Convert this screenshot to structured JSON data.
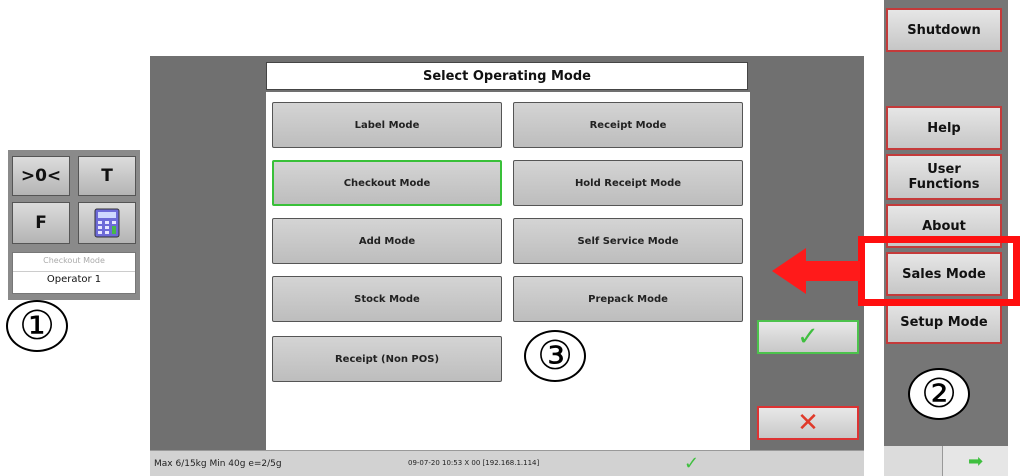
{
  "left_panel": {
    "zero_label": ">0<",
    "tare_label": "T",
    "f_label": "F",
    "mode_text": "Checkout Mode",
    "operator_text": "Operator 1"
  },
  "callouts": {
    "one": "①",
    "two": "②",
    "three": "③"
  },
  "dialog": {
    "title": "Select Operating Mode",
    "modes": [
      "Label Mode",
      "Receipt Mode",
      "Checkout Mode",
      "Hold Receipt Mode",
      "Add Mode",
      "Self Service Mode",
      "Stock Mode",
      "Prepack Mode",
      "Receipt (Non POS)"
    ],
    "ok_glyph": "✓",
    "cancel_glyph": "✕"
  },
  "status_bar": {
    "capacity": "Max 6/15kg Min 40g e=2/5g",
    "datetime_ip": "09-07-20 10:53 X 00 [192.168.1.114]",
    "check_glyph": "✓"
  },
  "right_menu": {
    "shutdown": "Shutdown",
    "help": "Help",
    "user_functions": "User Functions",
    "about": "About",
    "sales_mode": "Sales Mode",
    "setup_mode": "Setup Mode",
    "next_glyph": "➡"
  },
  "colors": {
    "selected_border": "#39c039",
    "highlight_red": "#ff0f0f",
    "ok_green": "#3fbf3f",
    "cancel_red": "#e03a2a"
  }
}
